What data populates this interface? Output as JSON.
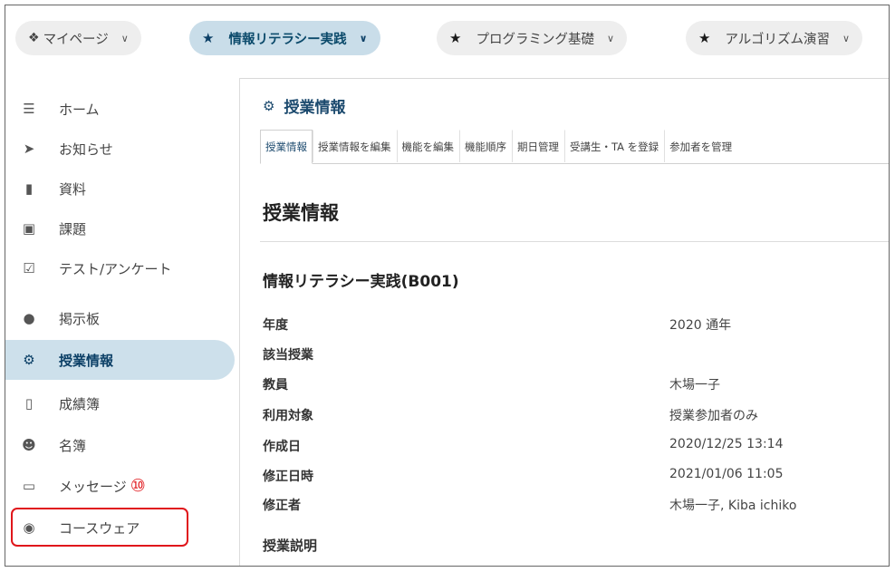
{
  "course_tabs": [
    {
      "label": "マイページ",
      "icon": "home-icon",
      "active": false
    },
    {
      "label": "情報リテラシー実践",
      "icon": "star-icon",
      "active": true
    },
    {
      "label": "プログラミング基礎",
      "icon": "star-icon",
      "active": false
    },
    {
      "label": "アルゴリズム演習",
      "icon": "star-icon",
      "active": false
    }
  ],
  "sidebar": {
    "items": [
      {
        "label": "ホーム",
        "icon": "list-icon"
      },
      {
        "label": "お知らせ",
        "icon": "megaphone-icon"
      },
      {
        "label": "資料",
        "icon": "folder-icon"
      },
      {
        "label": "課題",
        "icon": "file-icon"
      },
      {
        "label": "テスト/アンケート",
        "icon": "checkbox-icon"
      },
      {
        "label": "掲示板",
        "icon": "chat-icon"
      },
      {
        "label": "授業情報",
        "icon": "gear-icon",
        "active": true
      },
      {
        "label": "成績簿",
        "icon": "book-icon"
      },
      {
        "label": "名簿",
        "icon": "users-icon"
      },
      {
        "label": "メッセージ",
        "icon": "inbox-icon",
        "badge": "⑩"
      },
      {
        "label": "コースウェア",
        "icon": "globe-icon"
      }
    ]
  },
  "main": {
    "title": "授業情報",
    "tabs": [
      "授業情報",
      "授業情報を編集",
      "機能を編集",
      "機能順序",
      "期日管理",
      "受講生・TA を登録",
      "参加者を管理"
    ],
    "heading": "授業情報",
    "course_name": "情報リテラシー実践(B001)",
    "fields": [
      {
        "label": "年度",
        "value": "2020 通年"
      },
      {
        "label": "該当授業",
        "value": ""
      },
      {
        "label": "教員",
        "value": "木場一子"
      },
      {
        "label": "利用対象",
        "value": "授業参加者のみ"
      },
      {
        "label": "作成日",
        "value": "2020/12/25 13:14"
      },
      {
        "label": "修正日時",
        "value": "2021/01/06 11:05"
      },
      {
        "label": "修正者",
        "value": "木場一子, Kiba ichiko"
      }
    ],
    "description_heading": "授業説明"
  },
  "colors": {
    "accent": "#1c4a6e",
    "active_bg": "#cde0eb",
    "highlight": "#e0161b"
  }
}
